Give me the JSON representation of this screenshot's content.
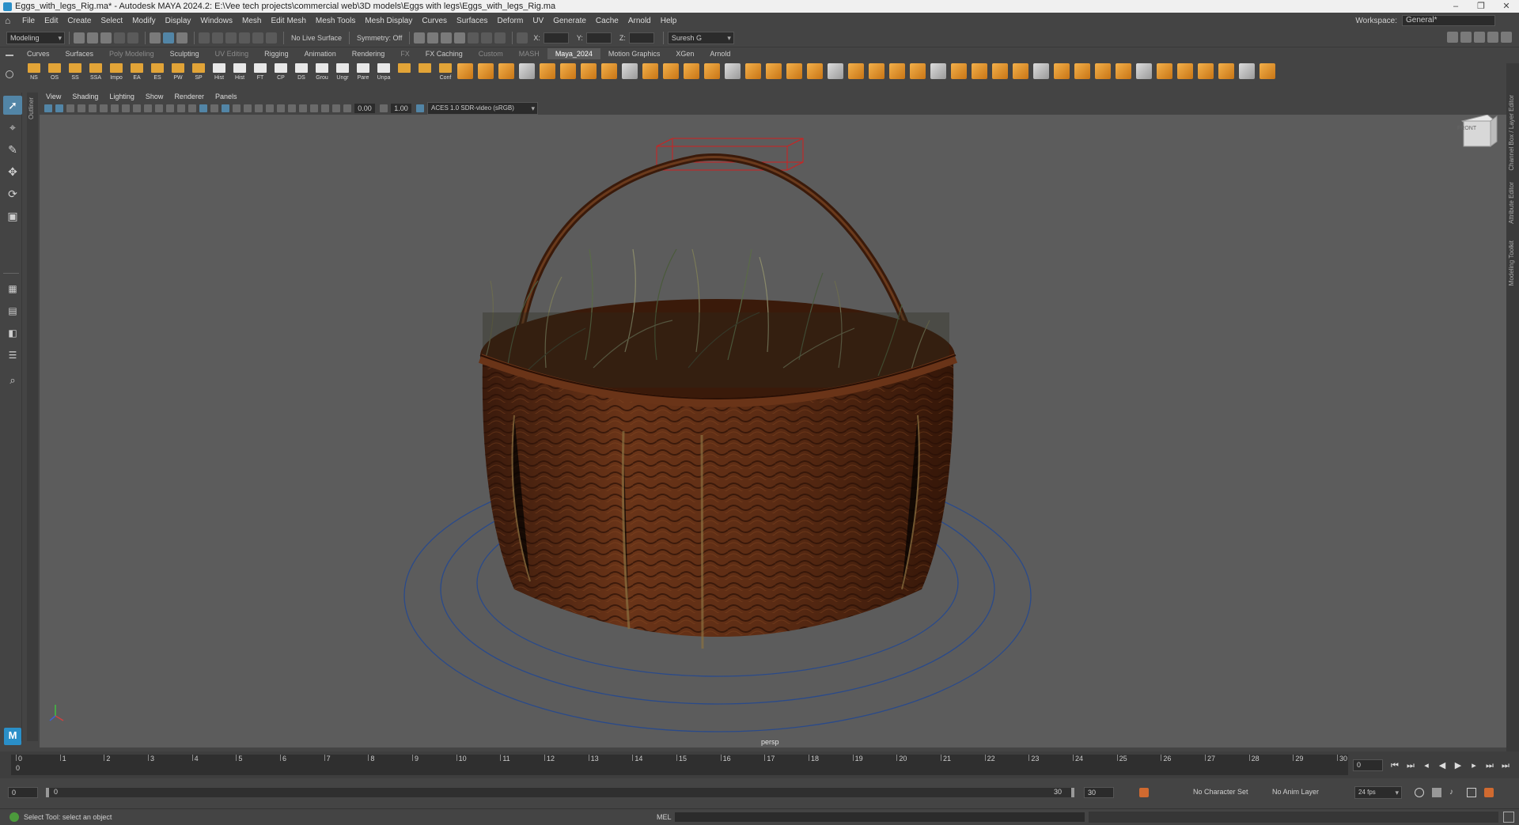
{
  "window": {
    "title": "Eggs_with_legs_Rig.ma* - Autodesk MAYA 2024.2: E:\\Vee tech projects\\commercial web\\3D models\\Eggs with legs\\Eggs_with_legs_Rig.ma",
    "controls": [
      "–",
      "❐",
      "✕"
    ]
  },
  "menubar": {
    "items": [
      "File",
      "Edit",
      "Create",
      "Select",
      "Modify",
      "Display",
      "Windows",
      "Mesh",
      "Edit Mesh",
      "Mesh Tools",
      "Mesh Display",
      "Curves",
      "Surfaces",
      "Deform",
      "UV",
      "Generate",
      "Cache",
      "Arnold",
      "Help"
    ],
    "workspace_label": "Workspace:",
    "workspace_value": "General*"
  },
  "statusline": {
    "mode": "Modeling",
    "live_surface": "No Live Surface",
    "symmetry": "Symmetry: Off",
    "x_label": "X:",
    "y_label": "Y:",
    "z_label": "Z:",
    "user": "Suresh G"
  },
  "shelf": {
    "tabs": [
      {
        "label": "Curves",
        "dim": false
      },
      {
        "label": "Surfaces",
        "dim": false
      },
      {
        "label": "Poly Modeling",
        "dim": true
      },
      {
        "label": "Sculpting",
        "dim": false
      },
      {
        "label": "UV Editing",
        "dim": true
      },
      {
        "label": "Rigging",
        "dim": false
      },
      {
        "label": "Animation",
        "dim": false
      },
      {
        "label": "Rendering",
        "dim": false
      },
      {
        "label": "FX",
        "dim": true
      },
      {
        "label": "FX Caching",
        "dim": false
      },
      {
        "label": "Custom",
        "dim": true
      },
      {
        "label": "MASH",
        "dim": true
      },
      {
        "label": "Maya_2024",
        "dim": false,
        "active": true
      },
      {
        "label": "Motion Graphics",
        "dim": false
      },
      {
        "label": "XGen",
        "dim": false
      },
      {
        "label": "Arnold",
        "dim": false
      }
    ],
    "buttons": [
      "NS",
      "OS",
      "SS",
      "SSA",
      "Impo",
      "EA",
      "ES",
      "PW",
      "SP",
      "Hist",
      "Hist",
      "FT",
      "CP",
      "DS",
      "Grou",
      "Ungr",
      "Pare",
      "Unpa",
      "",
      "",
      "Conf"
    ]
  },
  "panel": {
    "menus": [
      "View",
      "Shading",
      "Lighting",
      "Show",
      "Renderer",
      "Panels"
    ],
    "exposure": "0.00",
    "gamma": "1.00",
    "colorspace": "ACES 1.0 SDR-video (sRGB)",
    "camera_label": "persp",
    "viewcube_label": "FRONT"
  },
  "side_panels": {
    "outliner": "Outliner",
    "right": [
      "Channel Box / Layer Editor",
      "Attribute Editor",
      "Modeling Toolkit"
    ]
  },
  "timeslider": {
    "ticks": [
      "0",
      "1",
      "2",
      "3",
      "4",
      "5",
      "6",
      "7",
      "8",
      "9",
      "10",
      "11",
      "12",
      "13",
      "14",
      "15",
      "16",
      "17",
      "18",
      "19",
      "20",
      "21",
      "22",
      "23",
      "24",
      "25",
      "26",
      "27",
      "28",
      "29",
      "30"
    ],
    "current_frame": "0",
    "current_frame_marker": "0"
  },
  "range": {
    "start": "0",
    "range_start": "0",
    "range_end": "30",
    "end": "30",
    "character_set": "No Character Set",
    "anim_layer": "No Anim Layer",
    "fps": "24 fps"
  },
  "commandline": {
    "help": "Select Tool: select an object",
    "lang": "MEL"
  },
  "colors": {
    "accent": "#5285a6",
    "viewport_bg": "#5c5c5c",
    "basket": "#5a2c16",
    "selection_red": "#d02020"
  }
}
